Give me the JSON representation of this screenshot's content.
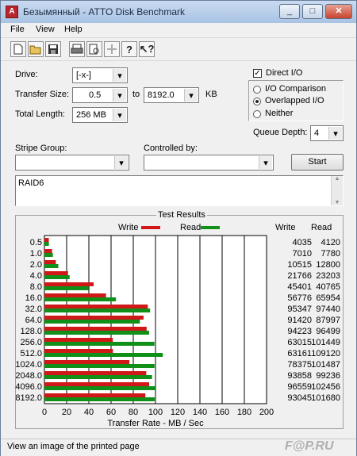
{
  "window": {
    "title": "Безымянный - ATTO Disk Benchmark",
    "minimize": "_",
    "maximize": "□",
    "close": "✕"
  },
  "menu": {
    "file": "File",
    "view": "View",
    "help": "Help"
  },
  "toolbar": {
    "icons": [
      "new-icon",
      "open-icon",
      "save-icon",
      "print-icon",
      "print-preview-icon",
      "move-icon",
      "help-icon",
      "context-help-icon"
    ]
  },
  "settings": {
    "drive_label": "Drive:",
    "drive_value": "[-x-]",
    "transfer_label": "Transfer Size:",
    "transfer_from": "0.5",
    "to_label": "to",
    "transfer_to": "8192.0",
    "kb_label": "KB",
    "length_label": "Total Length:",
    "length_value": "256 MB",
    "direct_io_label": "Direct I/O",
    "direct_io_checked": true,
    "io_comparison_label": "I/O Comparison",
    "overlapped_io_label": "Overlapped I/O",
    "neither_label": "Neither",
    "queue_depth_label": "Queue Depth:",
    "queue_depth_value": "4",
    "stripe_group_label": "Stripe Group:",
    "stripe_group_value": "",
    "controlled_by_label": "Controlled by:",
    "controlled_by_value": "",
    "start_label": "Start",
    "description": "RAID6"
  },
  "results": {
    "title": "Test Results",
    "write_legend": "Write",
    "read_legend": "Read",
    "write_col": "Write",
    "read_col": "Read",
    "xlabel": "Transfer Rate - MB / Sec"
  },
  "chart_data": {
    "type": "bar",
    "title": "Test Results",
    "xlabel": "Transfer Rate - MB / Sec",
    "xlim": [
      0,
      200
    ],
    "xticks": [
      "0",
      "20",
      "40",
      "60",
      "80",
      "100",
      "120",
      "140",
      "160",
      "180",
      "200"
    ],
    "categories": [
      "0.5",
      "1.0",
      "2.0",
      "4.0",
      "8.0",
      "16.0",
      "32.0",
      "64.0",
      "128.0",
      "256.0",
      "512.0",
      "1024.0",
      "2048.0",
      "4096.0",
      "8192.0"
    ],
    "series": [
      {
        "name": "Write",
        "color": "#d01818",
        "values": [
          4035,
          7010,
          10515,
          21766,
          45401,
          56776,
          95347,
          91420,
          94223,
          63015,
          63161,
          78375,
          93858,
          96559,
          93045
        ]
      },
      {
        "name": "Read",
        "color": "#109018",
        "values": [
          4120,
          7780,
          12800,
          23203,
          40765,
          65954,
          97440,
          87997,
          96499,
          101449,
          109120,
          101487,
          99236,
          102456,
          101680
        ]
      }
    ],
    "value_labels_write": [
      "4035",
      "7010",
      "10515",
      "21766",
      "45401",
      "56776",
      "95347",
      "91420",
      "94223",
      "63015",
      "63161",
      "78375",
      "93858",
      "96559",
      "93045"
    ],
    "value_labels_read": [
      "4120",
      "7780",
      "12800",
      "23203",
      "40765",
      "65954",
      "97440",
      "87997",
      "96499",
      "101449",
      "109120",
      "101487",
      "99236",
      "102456",
      "101680"
    ]
  },
  "status": {
    "text": "View an image of the printed page",
    "watermark": "F@P.RU"
  }
}
